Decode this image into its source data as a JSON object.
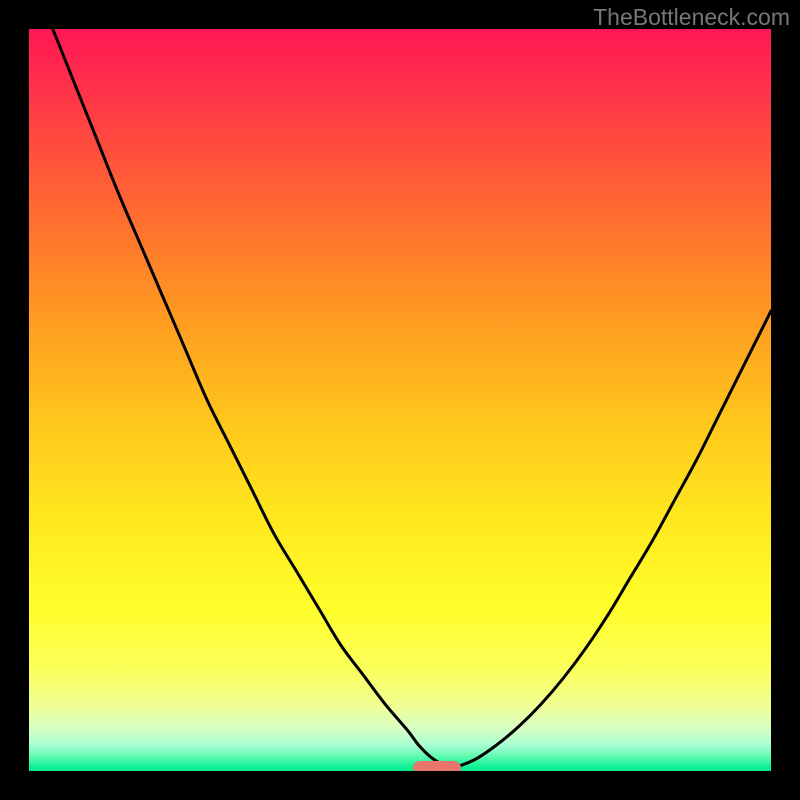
{
  "watermark": "TheBottleneck.com",
  "layout": {
    "canvas_size": 800,
    "plot_offset": 29,
    "plot_size": 742
  },
  "chart_data": {
    "type": "line",
    "title": "",
    "xlabel": "",
    "ylabel": "",
    "xlim": [
      0,
      100
    ],
    "ylim": [
      0,
      100
    ],
    "x": [
      0,
      3,
      6,
      9,
      12,
      15,
      18,
      21,
      24,
      27,
      30,
      33,
      36,
      39,
      42,
      45,
      48,
      51,
      52.5,
      54,
      55.5,
      57,
      60,
      63,
      66,
      69,
      72,
      75,
      78,
      81,
      84,
      87,
      90,
      93,
      96,
      99,
      100
    ],
    "values": [
      108,
      100.5,
      93,
      85.5,
      78,
      71,
      64,
      57,
      50,
      44,
      38,
      32,
      27,
      22,
      17,
      13,
      9,
      5.5,
      3.5,
      2,
      1,
      0.5,
      1.5,
      3.5,
      6,
      9,
      12.5,
      16.5,
      21,
      26,
      31,
      36.5,
      42,
      48,
      54,
      60,
      62
    ],
    "optimal_point": {
      "x": 55,
      "y": 0.4
    },
    "legend": null,
    "grid": false
  },
  "marker": {
    "position_label": ""
  }
}
